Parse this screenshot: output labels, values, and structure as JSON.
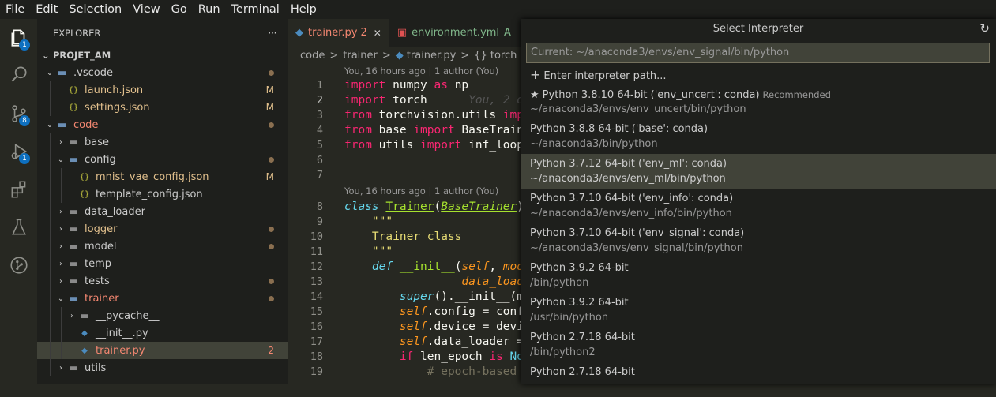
{
  "menu": [
    "File",
    "Edit",
    "Selection",
    "View",
    "Go",
    "Run",
    "Terminal",
    "Help"
  ],
  "activity": {
    "explorer_badge": "1",
    "scm_badge": "8",
    "run_badge": "1"
  },
  "sidebar": {
    "title": "EXPLORER",
    "more": "···",
    "project": "PROJET_AM",
    "tree": [
      {
        "label": ".vscode",
        "type": "folder-open",
        "depth": 1,
        "status": "dot"
      },
      {
        "label": "launch.json",
        "type": "json",
        "depth": 2,
        "status": "M"
      },
      {
        "label": "settings.json",
        "type": "json",
        "depth": 2,
        "status": "M"
      },
      {
        "label": "code",
        "type": "folder-open",
        "depth": 1,
        "status": "dot",
        "color": "red"
      },
      {
        "label": "base",
        "type": "folder",
        "depth": 2
      },
      {
        "label": "config",
        "type": "folder-open",
        "depth": 2,
        "status": "dot"
      },
      {
        "label": "mnist_vae_config.json",
        "type": "json",
        "depth": 3,
        "status": "M"
      },
      {
        "label": "template_config.json",
        "type": "json",
        "depth": 3
      },
      {
        "label": "data_loader",
        "type": "folder",
        "depth": 2
      },
      {
        "label": "logger",
        "type": "folder",
        "depth": 2,
        "status": "dot",
        "color": "yel"
      },
      {
        "label": "model",
        "type": "folder",
        "depth": 2,
        "status": "dot"
      },
      {
        "label": "temp",
        "type": "folder",
        "depth": 2
      },
      {
        "label": "tests",
        "type": "folder",
        "depth": 2,
        "status": "dot"
      },
      {
        "label": "trainer",
        "type": "folder-open",
        "depth": 2,
        "status": "dot",
        "color": "red"
      },
      {
        "label": "__pycache__",
        "type": "folder",
        "depth": 3
      },
      {
        "label": "__init__.py",
        "type": "py",
        "depth": 3
      },
      {
        "label": "trainer.py",
        "type": "py",
        "depth": 3,
        "status": "2",
        "color": "red",
        "selected": true
      },
      {
        "label": "utils",
        "type": "folder",
        "depth": 2
      }
    ]
  },
  "tabs": [
    {
      "label": "trainer.py",
      "badge": "2",
      "close": "✕",
      "active": true
    },
    {
      "label": "environment.yml",
      "badge": "A",
      "active": false
    }
  ],
  "breadcrumb": [
    "code",
    ">",
    "trainer",
    ">",
    "trainer.py",
    ">",
    "{} torch"
  ],
  "code": {
    "lens1": "You, 16 hours ago | 1 author (You)",
    "lens2": "You, 16 hours ago | 1 author (You)",
    "blame": "You, 2 d",
    "line_numbers": [
      "1",
      "2",
      "3",
      "4",
      "5",
      "6",
      "7",
      "8",
      "9",
      "10",
      "11",
      "12",
      "13",
      "14",
      "15",
      "16",
      "17",
      "18",
      "19"
    ]
  },
  "quickpick": {
    "title": "Select Interpreter",
    "placeholder": "Current: ~/anaconda3/envs/env_signal/bin/python",
    "enter_path": "Enter interpreter path...",
    "items": [
      {
        "star": "★",
        "name": "Python 3.8.10 64-bit ('env_uncert': conda)",
        "tag": "Recommended",
        "path": "~/anaconda3/envs/env_uncert/bin/python"
      },
      {
        "name": "Python 3.8.8 64-bit ('base': conda)",
        "path": "~/anaconda3/bin/python"
      },
      {
        "name": "Python 3.7.12 64-bit ('env_ml': conda)",
        "path": "~/anaconda3/envs/env_ml/bin/python",
        "highlight": true
      },
      {
        "name": "Python 3.7.10 64-bit ('env_info': conda)",
        "path": "~/anaconda3/envs/env_info/bin/python"
      },
      {
        "name": "Python 3.7.10 64-bit ('env_signal': conda)",
        "path": "~/anaconda3/envs/env_signal/bin/python"
      },
      {
        "name": "Python 3.9.2 64-bit",
        "path": "/bin/python"
      },
      {
        "name": "Python 3.9.2 64-bit",
        "path": "/usr/bin/python"
      },
      {
        "name": "Python 2.7.18 64-bit",
        "path": "/bin/python2"
      },
      {
        "name": "Python 2.7.18 64-bit",
        "path": ""
      }
    ]
  }
}
